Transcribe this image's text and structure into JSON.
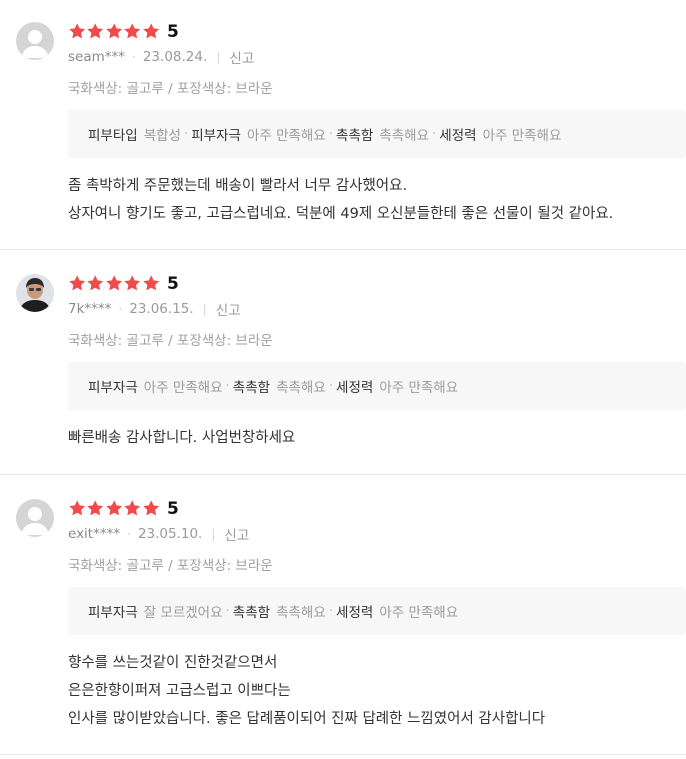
{
  "reviews": [
    {
      "avatar": "default-avatar",
      "rating": 5,
      "rating_label": "5",
      "user": "seam***",
      "date": "23.08.24.",
      "report": "신고",
      "options": "국화색상: 골고루 / 포장색상: 브라운",
      "survey": [
        {
          "key": "피부타입",
          "value": "복합성"
        },
        {
          "key": "피부자극",
          "value": "아주 만족해요"
        },
        {
          "key": "촉촉함",
          "value": "촉촉해요"
        },
        {
          "key": "세정력",
          "value": "아주 만족해요"
        }
      ],
      "content": [
        "좀 촉박하게 주문했는데 배송이 빨라서 너무 감사했어요.",
        "상자여니 향기도 좋고, 고급스럽네요. 덕분에 49제 오신분들한테 좋은 선물이 될것 같아요."
      ]
    },
    {
      "avatar": "photo-avatar",
      "rating": 5,
      "rating_label": "5",
      "user": "7k****",
      "date": "23.06.15.",
      "report": "신고",
      "options": "국화색상: 골고루 / 포장색상: 브라운",
      "survey": [
        {
          "key": "피부자극",
          "value": "아주 만족해요"
        },
        {
          "key": "촉촉함",
          "value": "촉촉해요"
        },
        {
          "key": "세정력",
          "value": "아주 만족해요"
        }
      ],
      "content": [
        "빠른배송 감사합니다. 사업번창하세요"
      ]
    },
    {
      "avatar": "default-avatar",
      "rating": 5,
      "rating_label": "5",
      "user": "exit****",
      "date": "23.05.10.",
      "report": "신고",
      "options": "국화색상: 골고루 / 포장색상: 브라운",
      "survey": [
        {
          "key": "피부자극",
          "value": "잘 모르겠어요"
        },
        {
          "key": "촉촉함",
          "value": "촉촉해요"
        },
        {
          "key": "세정력",
          "value": "아주 만족해요"
        }
      ],
      "content": [
        "향수를 쓰는것같이 진한것같으면서",
        "은은한향이퍼져 고급스럽고 이쁘다는",
        "인사를 많이받았습니다. 좋은 답례품이되어 진짜 답례한 느낌였어서 감사합니다"
      ]
    }
  ],
  "colors": {
    "star": "#f04a4a",
    "survey_bg": "#f7f7f8",
    "divider": "#e8e8e8"
  }
}
